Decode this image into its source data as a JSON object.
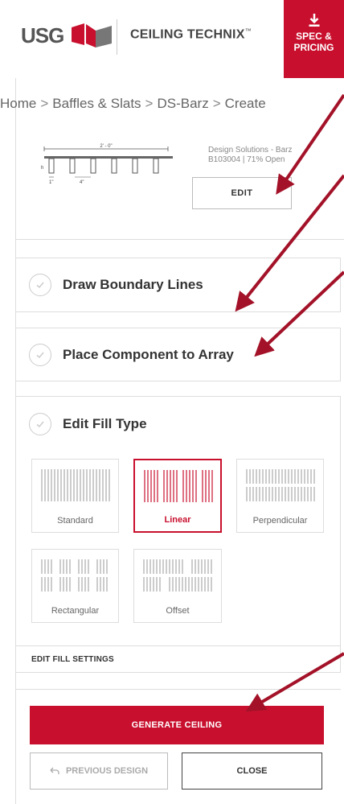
{
  "header": {
    "logo_text": "USG",
    "brand_name": "CEILING TECHNIX",
    "trademark": "™",
    "spec_button_label": "SPEC &\nPRICING",
    "spec_icon": "download-icon"
  },
  "breadcrumb": {
    "items": [
      "Home",
      "Baffles & Slats",
      "DS-Barz",
      "Create"
    ],
    "separator": ">"
  },
  "product": {
    "name": "Design Solutions - Barz",
    "code": "B103004 | 71% Open",
    "edit_label": "EDIT",
    "diagram": {
      "span_label": "2' - 0\"",
      "height_label": "h",
      "width_label": "1\"",
      "spacing_label": "4\""
    }
  },
  "steps": {
    "boundary": "Draw Boundary Lines",
    "place": "Place Component to Array",
    "fill": "Edit Fill Type"
  },
  "fill_types": [
    {
      "label": "Standard",
      "selected": false
    },
    {
      "label": "Linear",
      "selected": true
    },
    {
      "label": "Perpendicular",
      "selected": false
    },
    {
      "label": "Rectangular",
      "selected": false
    },
    {
      "label": "Offset",
      "selected": false
    }
  ],
  "fill_settings_label": "EDIT FILL SETTINGS",
  "actions": {
    "generate": "GENERATE CEILING",
    "previous": "PREVIOUS DESIGN",
    "close": "CLOSE"
  },
  "colors": {
    "accent": "#c8102e",
    "annotation_arrow": "#a31228"
  }
}
